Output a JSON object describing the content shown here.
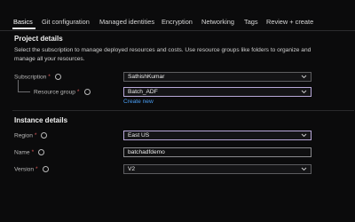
{
  "tabs": [
    {
      "label": "Basics",
      "active": true
    },
    {
      "label": "Git configuration"
    },
    {
      "label": "Managed identities"
    },
    {
      "label": "Encryption"
    },
    {
      "label": "Networking"
    },
    {
      "label": "Tags"
    },
    {
      "label": "Review + create"
    }
  ],
  "project": {
    "title": "Project details",
    "description": "Select the subscription to manage deployed resources and costs. Use resource groups like folders to organize and manage all your resources.",
    "subscription": {
      "label": "Subscription",
      "required": "*",
      "value": "SathishKumar"
    },
    "resource_group": {
      "label": "Resource group",
      "required": "*",
      "value": "Batch_ADF",
      "create_new": "Create new"
    }
  },
  "instance": {
    "title": "Instance details",
    "region": {
      "label": "Region",
      "required": "*",
      "value": "East US"
    },
    "name": {
      "label": "Name",
      "required": "*",
      "value": "batchadfdemo"
    },
    "version": {
      "label": "Version",
      "required": "*",
      "value": "V2"
    }
  },
  "colors": {
    "accent": "#4a9ff5",
    "required": "#e05a5a",
    "focus_border": "#b8a8d8"
  },
  "icons": [
    "info-icon",
    "chevron-down-icon"
  ]
}
